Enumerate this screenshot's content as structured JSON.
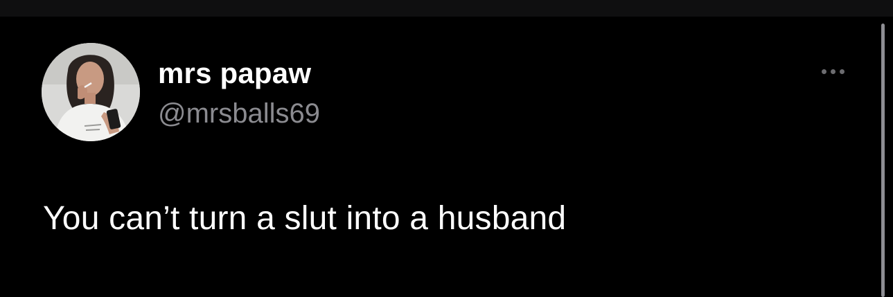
{
  "tweet": {
    "author": {
      "display_name": "mrs papaw",
      "handle": "@mrsballs69"
    },
    "text": "You can’t turn a slut into a husband",
    "more_icon": "more-horizontal-icon"
  },
  "colors": {
    "background": "#000000",
    "primary_text": "#ffffff",
    "secondary_text": "#8b8b90",
    "icon": "#6c6c70"
  }
}
